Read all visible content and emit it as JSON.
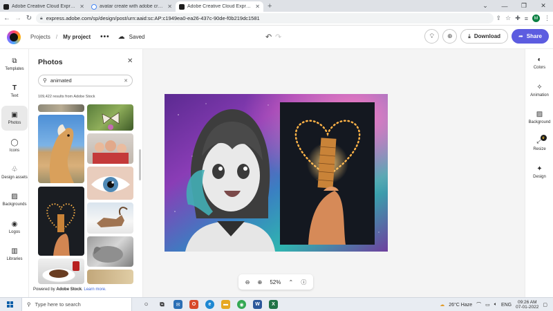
{
  "browser": {
    "tabs": [
      {
        "title": "Adobe Creative Cloud Express (B",
        "active": false,
        "favicon": "adobe-favicon"
      },
      {
        "title": "avatar create with adobe creativ",
        "active": false,
        "favicon": "google-favicon"
      },
      {
        "title": "Adobe Creative Cloud Express",
        "active": true,
        "favicon": "adobe-favicon"
      }
    ],
    "new_tab": "+",
    "url": "express.adobe.com/sp/design/post/urn:aaid:sc:AP:c1949ea0-ea26-437c-90de-f0b219dc1581",
    "profile_initial": "M"
  },
  "header": {
    "crumb_projects": "Projects",
    "crumb_separator": "/",
    "project_name": "My project",
    "more": "•••",
    "status": "Saved",
    "download_label": "Download",
    "share_label": "Share"
  },
  "left_rail": {
    "items": [
      {
        "label": "Templates",
        "icon": "templates-icon",
        "glyph": "⧉"
      },
      {
        "label": "Text",
        "icon": "text-icon",
        "glyph": "T"
      },
      {
        "label": "Photos",
        "icon": "photos-icon",
        "glyph": "▣"
      },
      {
        "label": "Icons",
        "icon": "icons-icon",
        "glyph": "◯"
      },
      {
        "label": "Design assets",
        "icon": "design-assets-icon",
        "glyph": "♧"
      },
      {
        "label": "Backgrounds",
        "icon": "backgrounds-icon",
        "glyph": "▨"
      },
      {
        "label": "Logos",
        "icon": "logos-icon",
        "glyph": "◉"
      },
      {
        "label": "Libraries",
        "icon": "libraries-icon",
        "glyph": "▥"
      }
    ],
    "active": "Photos"
  },
  "panel": {
    "title": "Photos",
    "search_value": "animated",
    "results": "109,422 results from Adobe Stock",
    "powered_prefix": "Powered by",
    "powered_brand": "Adobe Stock",
    "powered_link": "Learn more."
  },
  "canvas": {
    "zoom": "52%"
  },
  "right_rail": {
    "items": [
      {
        "label": "Colors",
        "icon": "colors-icon",
        "glyph": "◐"
      },
      {
        "label": "Animation",
        "icon": "animation-icon",
        "glyph": "✧"
      },
      {
        "label": "Background",
        "icon": "background-icon",
        "glyph": "▨"
      },
      {
        "label": "Resize",
        "icon": "resize-icon",
        "glyph": "⤢"
      },
      {
        "label": "Design",
        "icon": "design-icon",
        "glyph": "✦"
      }
    ]
  },
  "taskbar": {
    "search_placeholder": "Type here to search",
    "weather": "26°C  Haze",
    "language": "ENG",
    "time": "09:26 AM",
    "date": "07-01-2022"
  },
  "colors": {
    "accent": "#5c5ce0",
    "share_button": "#5c5ce0",
    "link": "#3b63d6"
  }
}
